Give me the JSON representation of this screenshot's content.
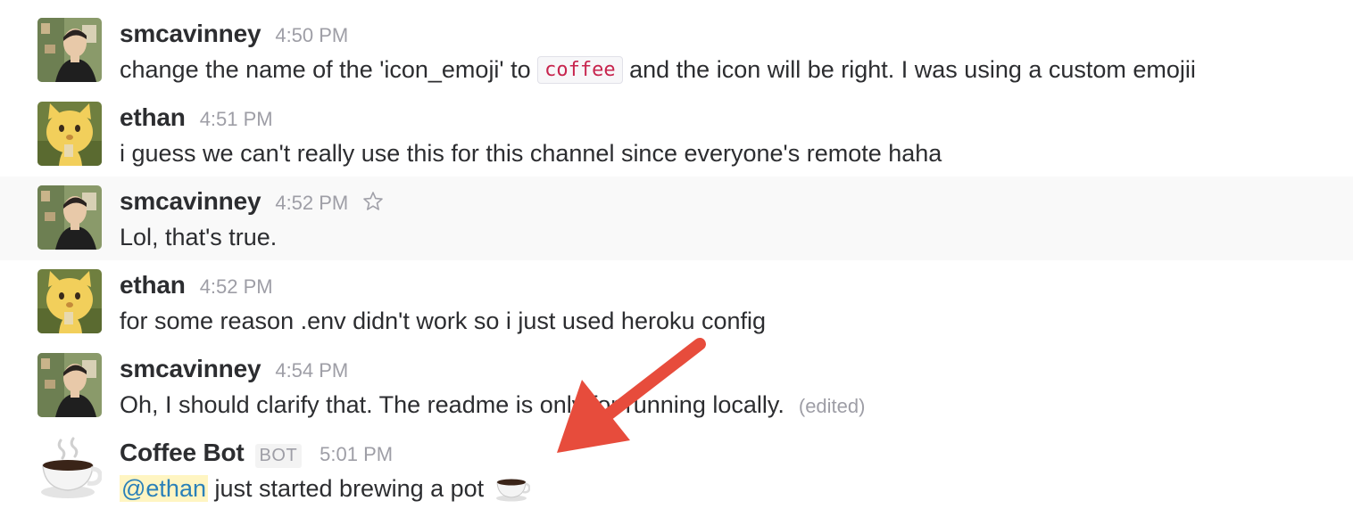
{
  "messages": [
    {
      "author": "smcavinney",
      "time": "4:50 PM",
      "text_before": "change the name of the 'icon_emoji' to ",
      "code": "coffee",
      "text_after": " and the icon will be right. I was using a custom emojii"
    },
    {
      "author": "ethan",
      "time": "4:51 PM",
      "text": "i guess we can't really use this for this channel since everyone's remote haha"
    },
    {
      "author": "smcavinney",
      "time": "4:52 PM",
      "text": "Lol, that's true."
    },
    {
      "author": "ethan",
      "time": "4:52 PM",
      "text": "for some reason .env didn't work so i just used heroku config"
    },
    {
      "author": "smcavinney",
      "time": "4:54 PM",
      "text": "Oh, I should clarify that. The readme is only for running locally.",
      "edited": "(edited)"
    },
    {
      "author": "Coffee Bot",
      "badge": "BOT",
      "time": "5:01 PM",
      "mention": "@ethan",
      "text": " just started brewing a pot"
    }
  ],
  "annotation": {
    "color": "#e74c3c"
  }
}
